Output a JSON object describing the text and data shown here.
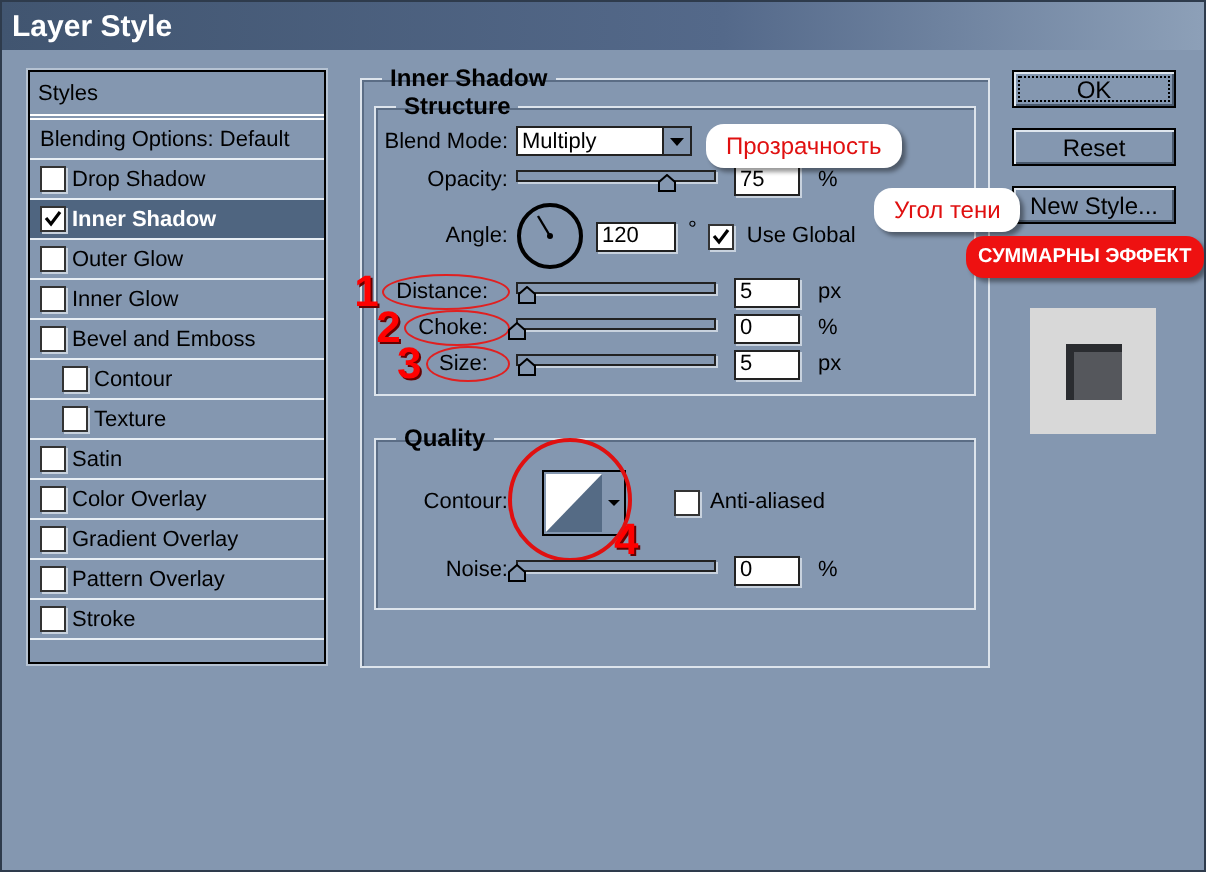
{
  "window": {
    "title": "Layer Style"
  },
  "styles_list": {
    "header": "Styles",
    "items": [
      {
        "kind": "plain",
        "label": "Blending Options: Default",
        "selected": false
      },
      {
        "kind": "checkbox",
        "label": "Drop Shadow",
        "checked": false,
        "selected": false
      },
      {
        "kind": "checkbox",
        "label": "Inner Shadow",
        "checked": true,
        "selected": true
      },
      {
        "kind": "checkbox",
        "label": "Outer Glow",
        "checked": false,
        "selected": false
      },
      {
        "kind": "checkbox",
        "label": "Inner Glow",
        "checked": false,
        "selected": false
      },
      {
        "kind": "checkbox",
        "label": "Bevel and Emboss",
        "checked": false,
        "selected": false,
        "children": [
          {
            "kind": "checkbox",
            "label": "Contour",
            "checked": false,
            "selected": false
          },
          {
            "kind": "checkbox",
            "label": "Texture",
            "checked": false,
            "selected": false
          }
        ]
      },
      {
        "kind": "checkbox",
        "label": "Satin",
        "checked": false,
        "selected": false
      },
      {
        "kind": "checkbox",
        "label": "Color Overlay",
        "checked": false,
        "selected": false
      },
      {
        "kind": "checkbox",
        "label": "Gradient Overlay",
        "checked": false,
        "selected": false
      },
      {
        "kind": "checkbox",
        "label": "Pattern Overlay",
        "checked": false,
        "selected": false
      },
      {
        "kind": "checkbox",
        "label": "Stroke",
        "checked": false,
        "selected": false
      }
    ]
  },
  "panel": {
    "title": "Inner Shadow",
    "structure": {
      "title": "Structure",
      "rows": [
        {
          "kind": "select",
          "label": "Blend Mode:",
          "value": "Multiply"
        },
        {
          "kind": "slider",
          "label": "Opacity:",
          "level": 0.75,
          "value": "75",
          "unit": "%"
        },
        {
          "kind": "angle",
          "label": "Angle:",
          "value": "120",
          "unit": "°",
          "checkbox": {
            "label": "Use Global",
            "checked": true
          }
        },
        {
          "kind": "slider",
          "label": "Distance:",
          "level": 0.05,
          "value": "5",
          "unit": "px",
          "marker": "1"
        },
        {
          "kind": "slider",
          "label": "Choke:",
          "level": 0,
          "value": "0",
          "unit": "%",
          "marker": "2"
        },
        {
          "kind": "slider",
          "label": "Size:",
          "level": 0.05,
          "value": "5",
          "unit": "px",
          "marker": "3"
        }
      ]
    },
    "quality": {
      "title": "Quality",
      "contour": {
        "label": "Contour:",
        "marker": "4"
      },
      "anti_aliased": {
        "label": "Anti-aliased",
        "checked": false
      },
      "noise": {
        "label": "Noise:",
        "level": 0,
        "value": "0",
        "unit": "%"
      }
    }
  },
  "buttons": [
    {
      "label": "OK",
      "default": true
    },
    {
      "label": "Reset",
      "default": false
    },
    {
      "label": "New Style...",
      "default": false
    }
  ],
  "callouts": [
    {
      "kind": "white",
      "text": "Прозрачность"
    },
    {
      "kind": "white",
      "text": "Угол тени"
    },
    {
      "kind": "red",
      "text": "СУММАРНЫ ЭФФЕКТ"
    }
  ]
}
